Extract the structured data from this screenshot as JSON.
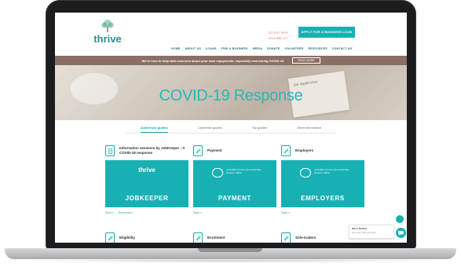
{
  "site": {
    "logo_text": "thrive",
    "logo_tagline": "",
    "contact_phone": "02 9747 0979",
    "contact_mobile": "0416 880 227",
    "apply_button": "APPLY FOR A BUSINESS LOAN",
    "nav": [
      "HOME",
      "ABOUT US",
      "LOANS",
      "FIND A BUSINESS",
      "MEDIA",
      "DONATE",
      "VOLUNTEER",
      "RESOURCES",
      "CONTACT US"
    ]
  },
  "banner": {
    "text": "We're here to help with concerns about your loan repayments, especially now during COVID-19.",
    "button": "READ MORE"
  },
  "hero": {
    "title": "COVID-19 Response",
    "paper_label": "Job Application"
  },
  "tabs": [
    {
      "label": "JobKeeper guides",
      "active": true
    },
    {
      "label": "Centrelink guides",
      "active": false
    },
    {
      "label": "Tax guides",
      "active": false
    },
    {
      "label": "Other information",
      "active": false
    }
  ],
  "cards_row1": [
    {
      "title": "Information sessions by JobKeeper : A COVID-19 response",
      "image_logo": "thrive",
      "image_tagline": "",
      "image_big": "JOBKEEPER",
      "image_sub": "",
      "links": [
        "View »",
        "Download »"
      ]
    },
    {
      "title": "Payment",
      "image_crest": "Australian Government Australian Taxation Office",
      "image_big": "PAYMENT",
      "image_sub": "",
      "links": [
        "View »"
      ]
    },
    {
      "title": "Employers",
      "image_crest": "Australian Government Australian Taxation Office",
      "image_big": "EMPLOYERS",
      "image_sub": "",
      "links": [
        "View »"
      ]
    }
  ],
  "cards_row2": [
    {
      "title": "Eligibility"
    },
    {
      "title": "Enrolment"
    },
    {
      "title": "Sole-traders"
    }
  ],
  "chat": {
    "title": "We're Online!",
    "subtitle": "How may I help you today?"
  },
  "colors": {
    "accent": "#17b1b4",
    "banner": "#8a6f64",
    "nav": "#1f6f73"
  }
}
